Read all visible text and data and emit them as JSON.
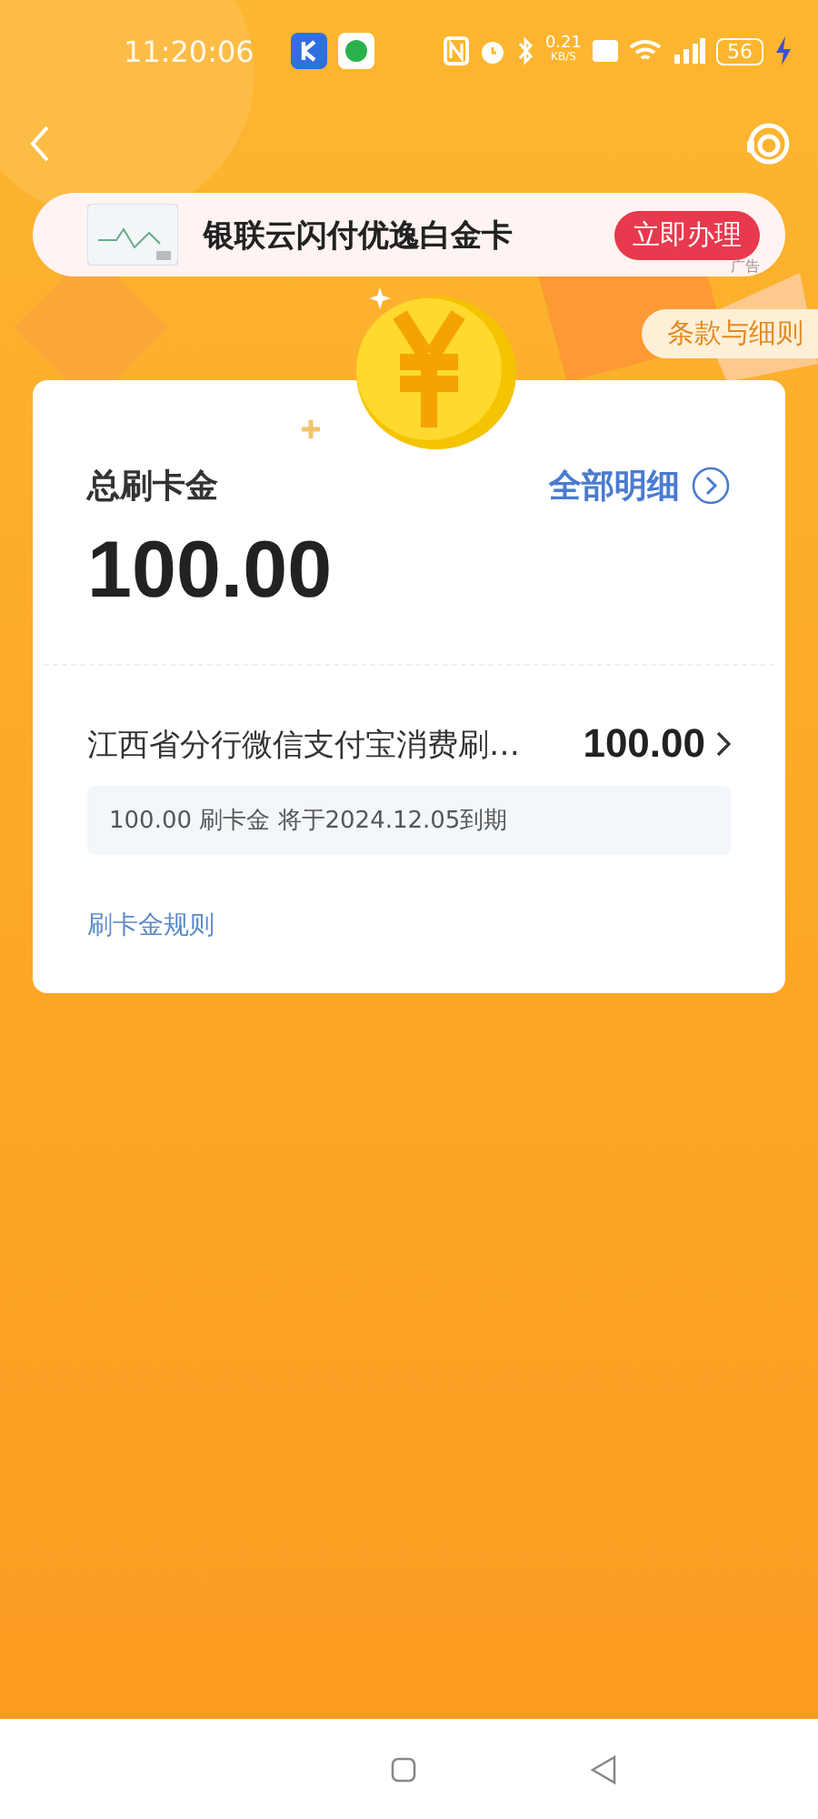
{
  "status_bar": {
    "time": "11:20:06",
    "net_speed": "0.21",
    "net_unit": "KB/S",
    "battery": "56"
  },
  "ad_banner": {
    "title": "银联云闪付优逸白金卡",
    "button": "立即办理",
    "ad_label": "广告"
  },
  "terms_link": "条款与细则",
  "summary": {
    "label": "总刷卡金",
    "details_link": "全部明细",
    "amount": "100.00"
  },
  "items": [
    {
      "title": "江西省分行微信支付宝消费刷…",
      "amount": "100.00",
      "note": "100.00 刷卡金 将于2024.12.05到期"
    }
  ],
  "rules_link": "刷卡金规则"
}
